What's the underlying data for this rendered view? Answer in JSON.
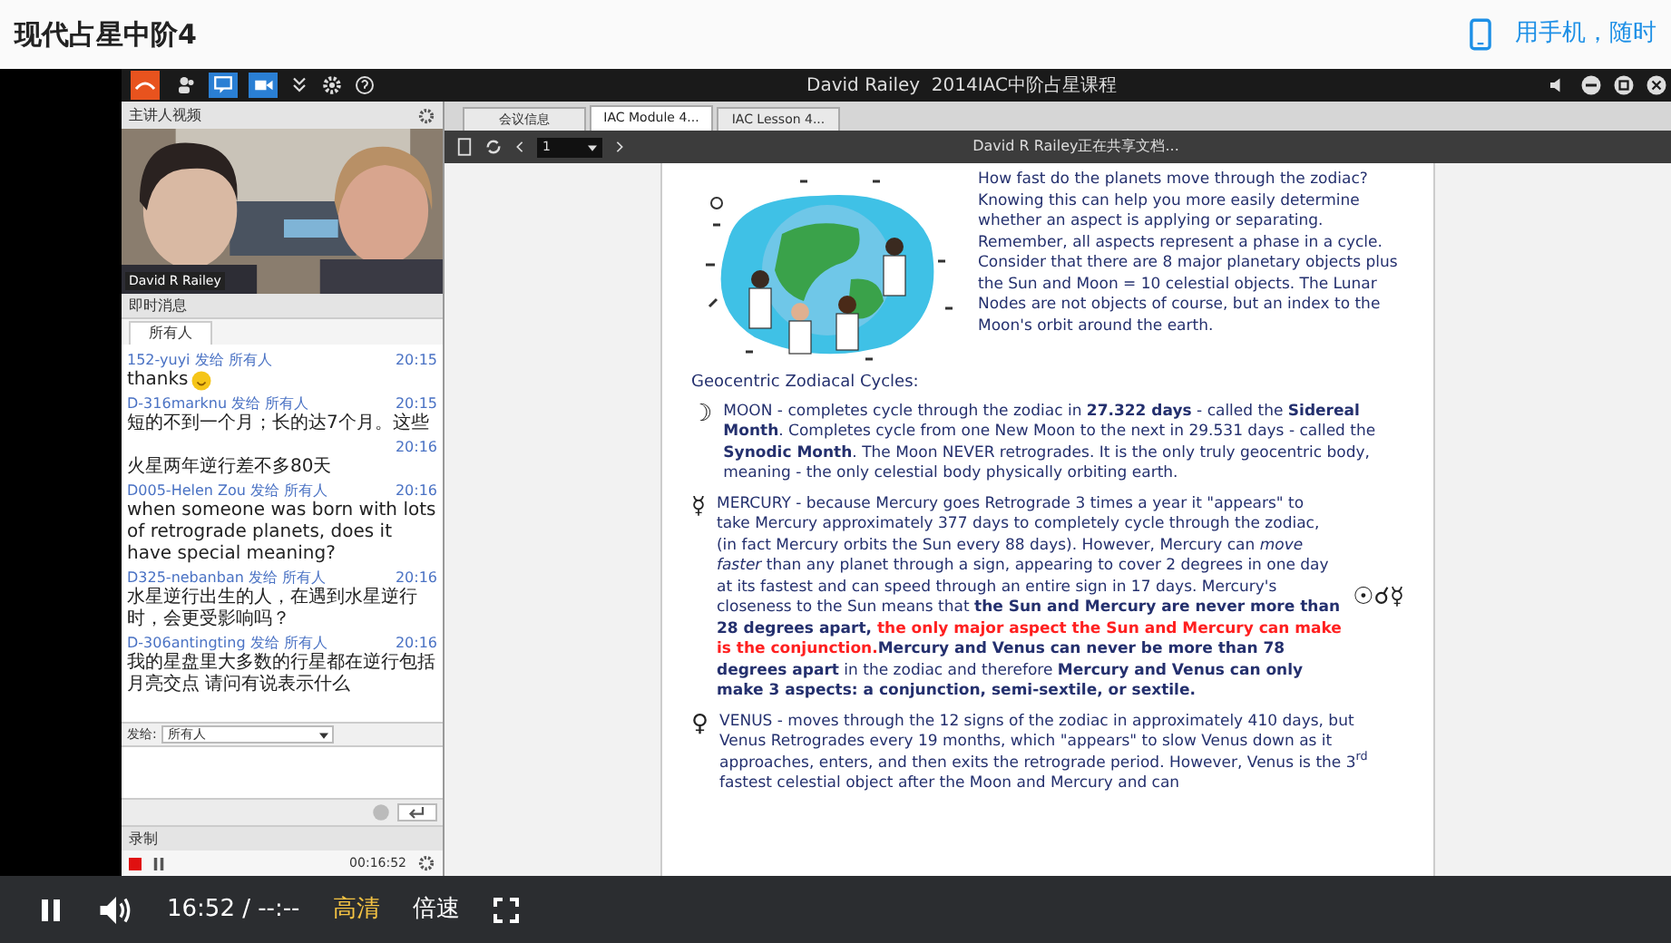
{
  "page": {
    "title": "现代占星中阶4",
    "mobile_link": "用手机，随时"
  },
  "app": {
    "title": "David Railey  2014IAC中阶占星课程"
  },
  "video_panel": {
    "title": "主讲人视频",
    "presenter": "David R Railey"
  },
  "chat": {
    "title": "即时消息",
    "audience_tab": "所有人",
    "messages": [
      {
        "sender": "152-yuyi 发给 所有人",
        "time": "20:15",
        "text": "thanks",
        "emoji": true
      },
      {
        "sender": "D-316marknu 发给 所有人",
        "time": "20:15",
        "text": "短的不到一个月；长的达7个月。这些",
        "emoji": false
      },
      {
        "time": "20:16",
        "text": "火星两年逆行差不多80天",
        "emoji": false
      },
      {
        "sender": "D005-Helen Zou 发给 所有人",
        "time": "20:16",
        "text": "when someone was born with lots of retrograde planets, does it have special meaning?",
        "emoji": false
      },
      {
        "sender": "D325-nebanban 发给 所有人",
        "time": "20:16",
        "text": "水星逆行出生的人，在遇到水星逆行时，会更受影响吗？",
        "emoji": false
      },
      {
        "sender": "D-306antingting 发给 所有人",
        "time": "20:16",
        "text": "我的星盘里大多数的行星都在逆行包括月亮交点 请问有说表示什么",
        "emoji": false
      }
    ],
    "send_to_label": "发给:",
    "send_to": "所有人"
  },
  "recording": {
    "title": "录制",
    "elapsed": "00:16:52"
  },
  "tabs": [
    {
      "label": "会议信息",
      "selected": false
    },
    {
      "label": "IAC Module 4...",
      "selected": true
    },
    {
      "label": "IAC Lesson 4...",
      "selected": false
    }
  ],
  "viewer": {
    "page": "1",
    "status": "David R Railey正在共享文档..."
  },
  "document": {
    "intro": "How fast do the planets move through the zodiac?  Knowing this can help you more easily determine whether an aspect is applying or separating.  Remember, all aspects represent a phase in a cycle.  Consider that there are 8 major planetary objects plus the Sun and Moon = 10 celestial objects. The Lunar Nodes are not objects of course, but an index to the Moon's orbit around the earth.",
    "heading": "Geocentric Zodiacal Cycles:",
    "sections": [
      {
        "symbol": "☽",
        "segments": [
          {
            "kind": "normal",
            "text": "MOON - completes cycle through the zodiac in **27.322 days** - called the **Sidereal Month**.  Completes cycle from one New Moon to the next in 29.531 days - called the **Synodic Month**.  The Moon NEVER retrogrades.  It is the only truly geocentric body, meaning - the only celestial body physically orbiting earth."
          }
        ]
      },
      {
        "symbol": "☿",
        "aside": "☉☌☿",
        "segments": [
          {
            "kind": "normal",
            "text": "MERCURY - because Mercury goes Retrograde 3 times a year it \"appears\" to take Mercury approximately 377 days to completely cycle through the zodiac, (in fact Mercury orbits the Sun every 88 days).  However, Mercury can *move faster* than any planet through a sign, appearing to cover 2 degrees in one day at its fastest and can speed through an entire sign in 17 days.  Mercury's closeness to the Sun means that "
          },
          {
            "kind": "bold",
            "text": "the Sun and Mercury are never more than 28 degrees apart,"
          },
          {
            "kind": "alert",
            "text": " the only major aspect the Sun and Mercury can make is the conjunction."
          },
          {
            "kind": "bold",
            "text": "Mercury and Venus can never be more than 78 degrees apart"
          },
          {
            "kind": "normal",
            "text": " in the zodiac and therefore "
          },
          {
            "kind": "bold",
            "text": "Mercury and Venus can only make 3 aspects: a conjunction, semi-sextile, or sextile."
          }
        ]
      },
      {
        "symbol": "♀",
        "segments": [
          {
            "kind": "normal",
            "text": "VENUS - moves through the 12 signs of the zodiac in approximately 410 days, but Venus Retrogrades every 19 months, which \"appears\" to slow Venus down as it approaches, enters, and then exits the retrograde period.  However, Venus is the 3$^{rd}$ fastest celestial object after the Moon and Mercury and can"
          }
        ]
      }
    ]
  },
  "player": {
    "time": "16:52 / --:--",
    "quality": "高清",
    "speed": "倍速"
  }
}
